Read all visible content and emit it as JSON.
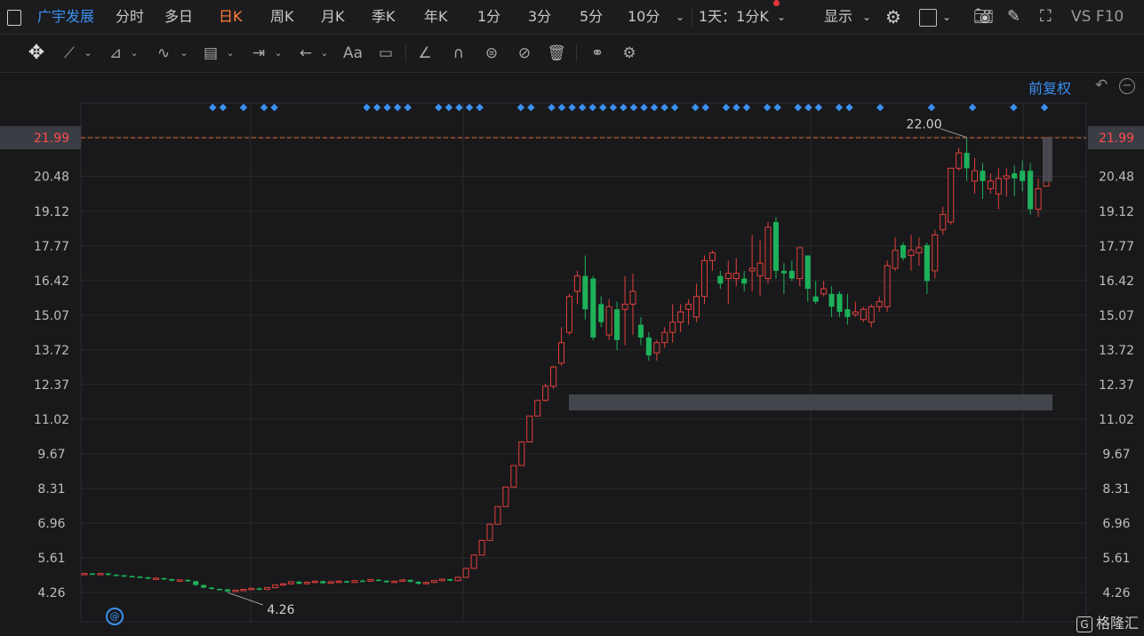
{
  "stock_name": "广宇发展",
  "periods": [
    "分时",
    "多日",
    "日K",
    "周K",
    "月K",
    "季K",
    "年K",
    "1分",
    "3分",
    "5分",
    "10分"
  ],
  "active_period": "日K",
  "period_dropdown": "1天：1分K",
  "display_label": "显示",
  "top_right_text": "VS F10",
  "adjust_label": "前复权",
  "brand": "格隆汇",
  "colors": {
    "up": "#e0403c",
    "down": "#1db15a",
    "bg": "#19191b",
    "grid": "#2a2a2e",
    "accent": "#3b8ff0",
    "active": "#ff7e3a"
  },
  "chart_data": {
    "type": "candlestick",
    "y_ticks": [
      "21.99",
      "20.48",
      "19.12",
      "17.77",
      "16.42",
      "15.07",
      "13.72",
      "12.37",
      "11.02",
      "9.67",
      "8.31",
      "6.96",
      "5.61",
      "4.26"
    ],
    "ylim": [
      4.26,
      21.99
    ],
    "current_price_line": 21.99,
    "annotations": [
      {
        "text": "22.00",
        "type": "high"
      },
      {
        "text": "4.26",
        "type": "low"
      }
    ],
    "candles": [
      [
        4.95,
        5.0,
        4.95,
        5.02
      ],
      [
        5.0,
        4.98,
        4.95,
        5.02
      ],
      [
        4.98,
        5.0,
        4.96,
        5.03
      ],
      [
        5.0,
        4.95,
        4.92,
        5.02
      ],
      [
        4.95,
        4.93,
        4.9,
        4.98
      ],
      [
        4.93,
        4.9,
        4.86,
        4.95
      ],
      [
        4.9,
        4.88,
        4.85,
        4.92
      ],
      [
        4.88,
        4.85,
        4.82,
        4.9
      ],
      [
        4.85,
        4.8,
        4.77,
        4.88
      ],
      [
        4.8,
        4.82,
        4.78,
        4.85
      ],
      [
        4.82,
        4.78,
        4.75,
        4.84
      ],
      [
        4.78,
        4.72,
        4.7,
        4.8
      ],
      [
        4.72,
        4.75,
        4.7,
        4.78
      ],
      [
        4.75,
        4.7,
        4.67,
        4.77
      ],
      [
        4.7,
        4.55,
        4.52,
        4.72
      ],
      [
        4.55,
        4.45,
        4.42,
        4.57
      ],
      [
        4.45,
        4.4,
        4.37,
        4.48
      ],
      [
        4.4,
        4.38,
        4.35,
        4.42
      ],
      [
        4.38,
        4.3,
        4.26,
        4.4
      ],
      [
        4.3,
        4.35,
        4.28,
        4.37
      ],
      [
        4.35,
        4.38,
        4.32,
        4.4
      ],
      [
        4.38,
        4.42,
        4.35,
        4.45
      ],
      [
        4.42,
        4.38,
        4.34,
        4.45
      ],
      [
        4.38,
        4.45,
        4.35,
        4.48
      ],
      [
        4.45,
        4.55,
        4.42,
        4.58
      ],
      [
        4.55,
        4.6,
        4.52,
        4.63
      ],
      [
        4.6,
        4.68,
        4.56,
        4.7
      ],
      [
        4.68,
        4.6,
        4.57,
        4.72
      ],
      [
        4.6,
        4.66,
        4.58,
        4.69
      ],
      [
        4.66,
        4.7,
        4.62,
        4.73
      ],
      [
        4.7,
        4.62,
        4.59,
        4.72
      ],
      [
        4.62,
        4.68,
        4.6,
        4.71
      ],
      [
        4.68,
        4.7,
        4.65,
        4.74
      ],
      [
        4.7,
        4.65,
        4.62,
        4.73
      ],
      [
        4.65,
        4.72,
        4.63,
        4.75
      ],
      [
        4.72,
        4.7,
        4.67,
        4.76
      ],
      [
        4.7,
        4.76,
        4.68,
        4.79
      ],
      [
        4.76,
        4.72,
        4.69,
        4.78
      ],
      [
        4.72,
        4.66,
        4.63,
        4.74
      ],
      [
        4.66,
        4.7,
        4.64,
        4.73
      ],
      [
        4.7,
        4.75,
        4.67,
        4.78
      ],
      [
        4.75,
        4.68,
        4.65,
        4.77
      ],
      [
        4.68,
        4.6,
        4.57,
        4.7
      ],
      [
        4.6,
        4.65,
        4.58,
        4.68
      ],
      [
        4.65,
        4.72,
        4.63,
        4.75
      ],
      [
        4.72,
        4.78,
        4.69,
        4.81
      ],
      [
        4.78,
        4.72,
        4.69,
        4.8
      ],
      [
        4.72,
        4.85,
        4.7,
        4.88
      ],
      [
        4.85,
        5.2,
        4.85,
        5.2
      ],
      [
        5.2,
        5.72,
        5.2,
        5.72
      ],
      [
        5.72,
        6.29,
        5.72,
        6.29
      ],
      [
        6.29,
        6.92,
        6.29,
        6.92
      ],
      [
        6.92,
        7.61,
        6.92,
        7.61
      ],
      [
        7.61,
        8.37,
        7.61,
        8.37
      ],
      [
        8.37,
        9.21,
        8.37,
        9.21
      ],
      [
        9.21,
        10.13,
        9.21,
        10.13
      ],
      [
        10.13,
        11.14,
        10.13,
        11.14
      ],
      [
        11.14,
        11.75,
        11.14,
        11.75
      ],
      [
        11.75,
        12.3,
        11.7,
        12.4
      ],
      [
        12.3,
        13.05,
        12.2,
        13.1
      ],
      [
        13.2,
        14.0,
        13.1,
        14.6
      ],
      [
        14.4,
        15.8,
        14.3,
        15.9
      ],
      [
        16.0,
        16.6,
        15.5,
        16.8
      ],
      [
        16.6,
        15.3,
        14.9,
        17.4
      ],
      [
        16.5,
        14.2,
        14.1,
        16.6
      ],
      [
        15.5,
        14.8,
        14.6,
        15.8
      ],
      [
        14.3,
        15.4,
        14.1,
        15.7
      ],
      [
        15.3,
        14.1,
        13.7,
        15.6
      ],
      [
        15.3,
        15.5,
        13.9,
        16.6
      ],
      [
        15.5,
        16.0,
        14.3,
        16.7
      ],
      [
        14.7,
        14.2,
        13.9,
        15.0
      ],
      [
        14.2,
        13.5,
        13.3,
        14.4
      ],
      [
        13.6,
        14.0,
        13.3,
        14.1
      ],
      [
        14.0,
        14.4,
        13.8,
        14.6
      ],
      [
        14.4,
        14.8,
        14.0,
        15.5
      ],
      [
        14.8,
        15.2,
        14.4,
        15.5
      ],
      [
        15.3,
        15.5,
        14.7,
        15.7
      ],
      [
        15.0,
        15.8,
        14.8,
        16.3
      ],
      [
        15.8,
        17.2,
        15.5,
        17.4
      ],
      [
        17.2,
        17.5,
        16.8,
        17.6
      ],
      [
        16.6,
        16.3,
        16.1,
        16.8
      ],
      [
        16.5,
        16.7,
        15.5,
        17.2
      ],
      [
        16.5,
        16.7,
        16.2,
        17.3
      ],
      [
        16.5,
        16.3,
        16.0,
        16.8
      ],
      [
        16.8,
        16.9,
        16.0,
        18.2
      ],
      [
        16.6,
        17.1,
        15.8,
        18.0
      ],
      [
        16.5,
        18.5,
        16.3,
        18.7
      ],
      [
        18.7,
        16.8,
        16.5,
        18.9
      ],
      [
        16.8,
        16.7,
        15.9,
        17.1
      ],
      [
        16.8,
        16.5,
        16.4,
        17.2
      ],
      [
        16.5,
        17.7,
        16.2,
        17.7
      ],
      [
        17.4,
        16.1,
        15.6,
        17.4
      ],
      [
        15.8,
        15.6,
        15.5,
        16.4
      ],
      [
        15.9,
        16.1,
        15.8,
        16.4
      ],
      [
        15.9,
        15.4,
        15.0,
        16.2
      ],
      [
        15.9,
        15.2,
        15.0,
        16.0
      ],
      [
        15.3,
        15.0,
        14.7,
        15.9
      ],
      [
        15.1,
        15.2,
        15.0,
        15.6
      ],
      [
        14.9,
        15.3,
        14.8,
        15.4
      ],
      [
        14.8,
        15.4,
        14.6,
        15.5
      ],
      [
        15.4,
        15.6,
        15.2,
        15.8
      ],
      [
        15.4,
        17.0,
        15.2,
        17.2
      ],
      [
        16.9,
        17.6,
        16.8,
        18.1
      ],
      [
        17.8,
        17.3,
        17.2,
        17.9
      ],
      [
        17.4,
        17.6,
        16.8,
        18.2
      ],
      [
        17.5,
        17.7,
        17.0,
        18.1
      ],
      [
        17.8,
        16.4,
        15.9,
        17.9
      ],
      [
        16.8,
        18.2,
        16.5,
        18.4
      ],
      [
        18.4,
        19.0,
        18.2,
        19.3
      ],
      [
        18.7,
        20.8,
        18.6,
        20.8
      ],
      [
        20.8,
        21.4,
        20.7,
        21.6
      ],
      [
        21.4,
        20.8,
        20.3,
        22.0
      ],
      [
        20.3,
        20.7,
        19.8,
        21.2
      ],
      [
        20.7,
        20.3,
        19.6,
        21.0
      ],
      [
        20.0,
        20.3,
        19.8,
        20.6
      ],
      [
        19.8,
        20.4,
        19.2,
        20.8
      ],
      [
        20.4,
        20.5,
        19.7,
        20.8
      ],
      [
        20.6,
        20.4,
        19.7,
        20.9
      ],
      [
        20.7,
        20.3,
        19.9,
        21.1
      ],
      [
        20.7,
        19.2,
        19.0,
        21.0
      ],
      [
        19.2,
        20.0,
        18.9,
        20.4
      ],
      [
        20.1,
        21.99,
        20.1,
        21.99
      ]
    ]
  }
}
